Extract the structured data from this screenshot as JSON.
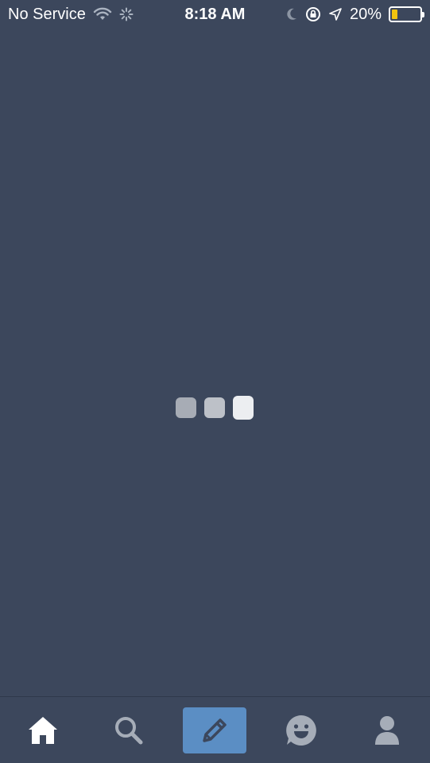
{
  "status_bar": {
    "carrier": "No Service",
    "time": "8:18 AM",
    "battery_percent": "20%",
    "battery_level": 0.2,
    "icons": [
      "wifi-icon",
      "activity-spinner-icon",
      "moon-icon",
      "rotation-lock-icon",
      "location-arrow-icon",
      "battery-icon"
    ]
  },
  "loader": {
    "icon": "loading-dots-icon"
  },
  "tab_bar": {
    "tabs": [
      {
        "icon": "home-icon",
        "active": true
      },
      {
        "icon": "search-icon",
        "active": false
      },
      {
        "icon": "pencil-icon",
        "active": false
      },
      {
        "icon": "smiley-chat-icon",
        "active": false
      },
      {
        "icon": "person-icon",
        "active": false
      }
    ],
    "colors": {
      "active": "#ffffff",
      "inactive": "#a6adb8",
      "compose_bg": "#5b8ec4",
      "background": "#3c475c"
    }
  }
}
